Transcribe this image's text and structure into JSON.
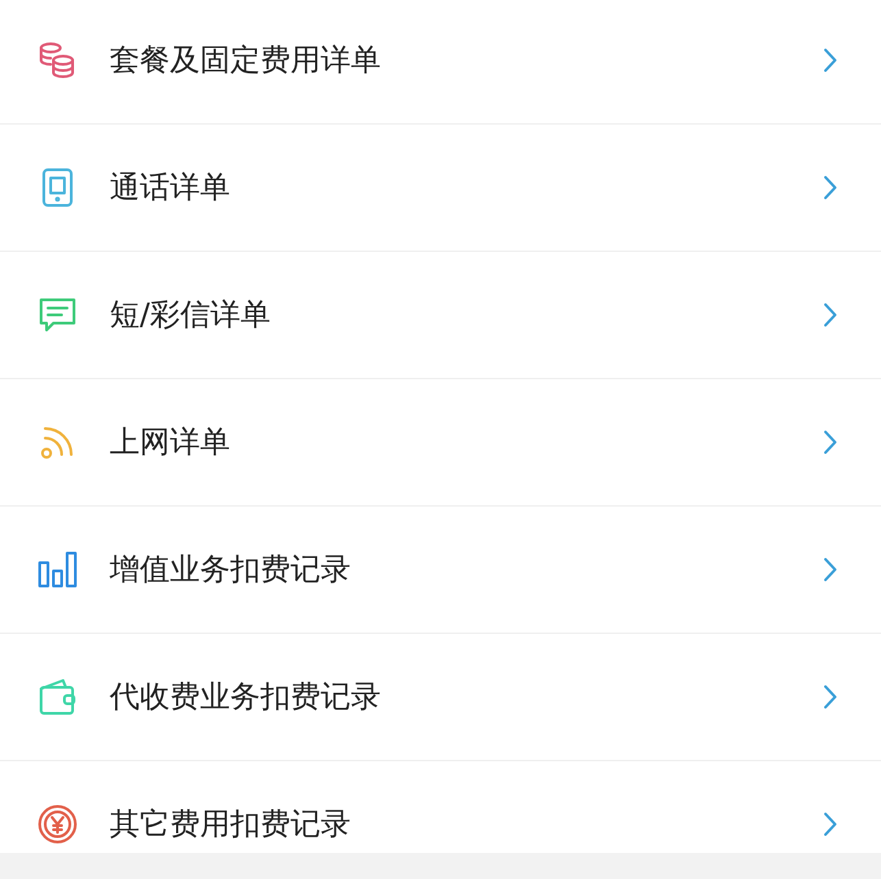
{
  "menu_items": [
    {
      "label": "套餐及固定费用详单",
      "kind": "coins"
    },
    {
      "label": "通话详单",
      "kind": "phone"
    },
    {
      "label": "短/彩信详单",
      "kind": "message"
    },
    {
      "label": "上网详单",
      "kind": "signal"
    },
    {
      "label": "增值业务扣费记录",
      "kind": "bars"
    },
    {
      "label": "代收费业务扣费记录",
      "kind": "wallet"
    },
    {
      "label": "其它费用扣费记录",
      "kind": "yen"
    }
  ]
}
